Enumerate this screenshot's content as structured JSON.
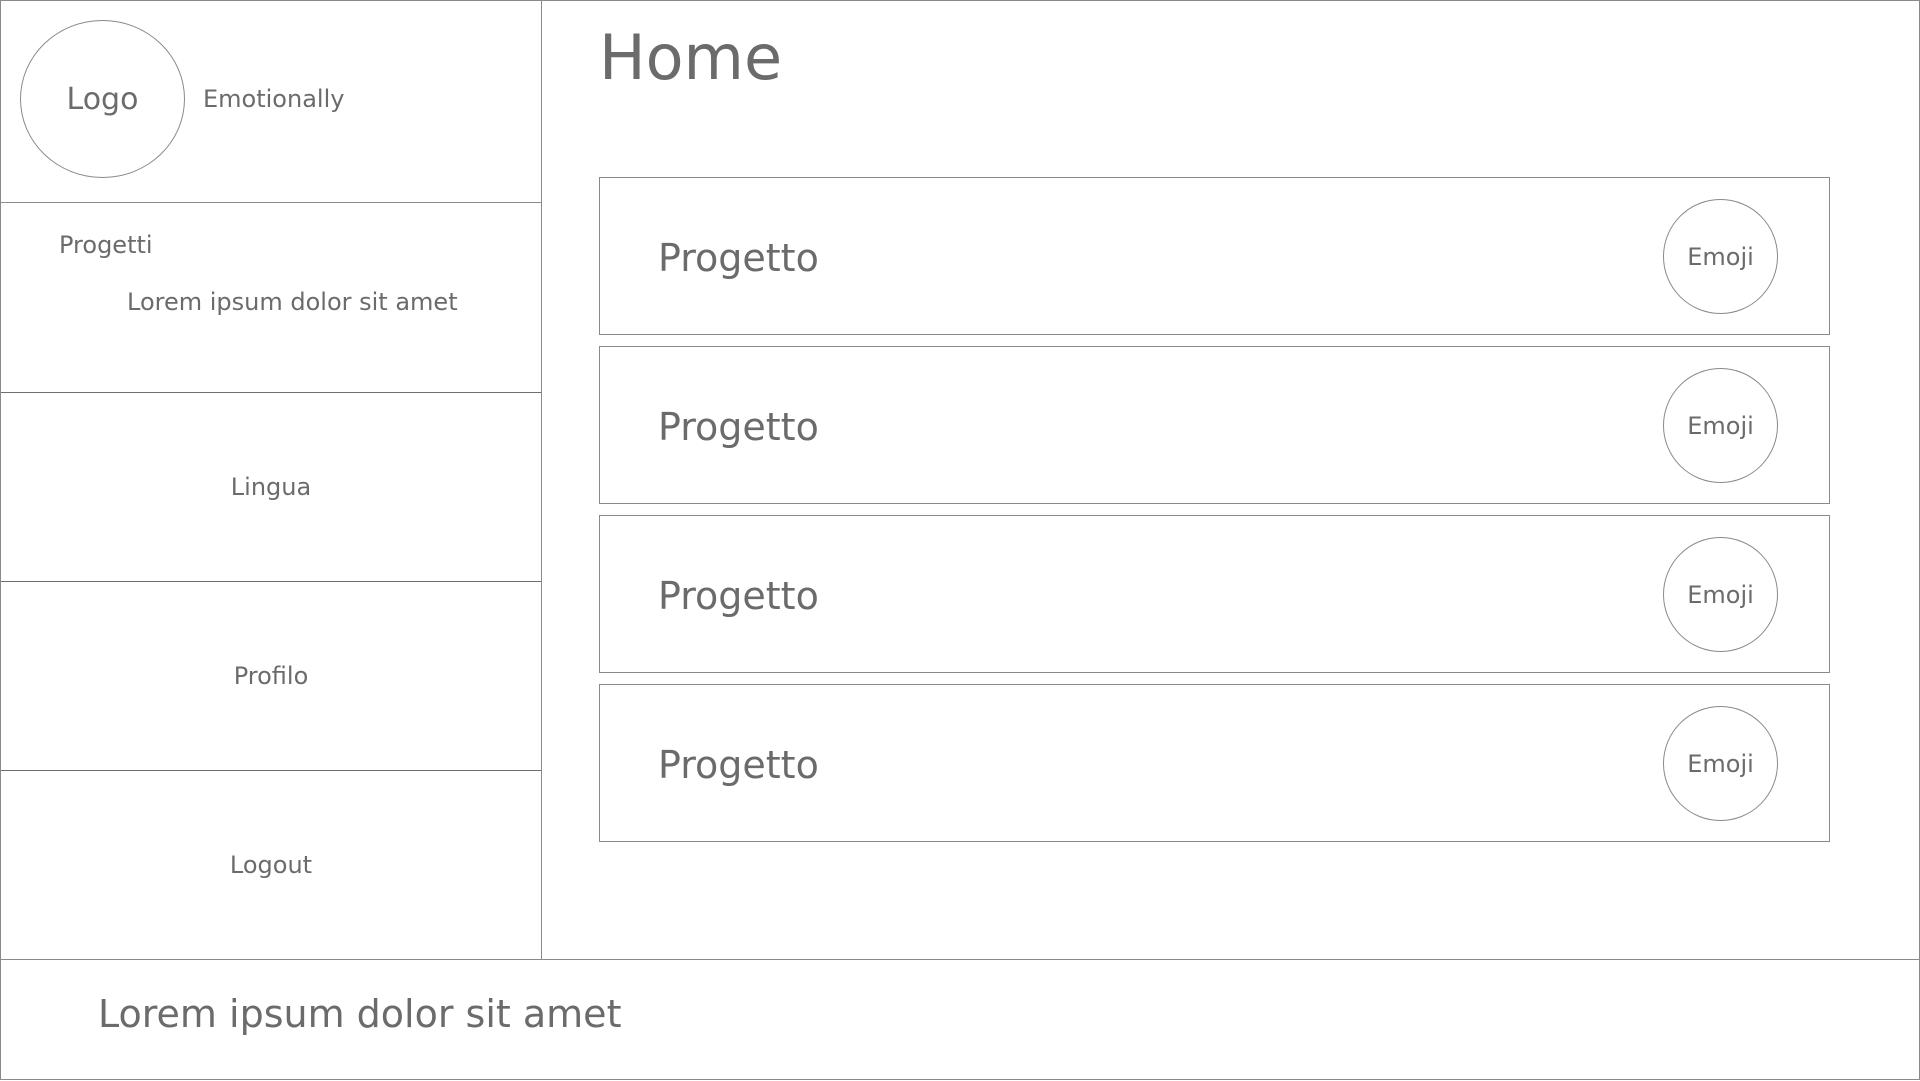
{
  "sidebar": {
    "logo_label": "Logo",
    "app_name": "Emotionally",
    "projects": {
      "title": "Progetti",
      "description": "Lorem ipsum dolor sit amet"
    },
    "items": [
      {
        "label": "Lingua"
      },
      {
        "label": "Profilo"
      },
      {
        "label": "Logout"
      }
    ]
  },
  "main": {
    "title": "Home",
    "projects": [
      {
        "name": "Progetto",
        "emoji_label": "Emoji"
      },
      {
        "name": "Progetto",
        "emoji_label": "Emoji"
      },
      {
        "name": "Progetto",
        "emoji_label": "Emoji"
      },
      {
        "name": "Progetto",
        "emoji_label": "Emoji"
      }
    ]
  },
  "footer": {
    "text": "Lorem ipsum dolor sit amet"
  }
}
